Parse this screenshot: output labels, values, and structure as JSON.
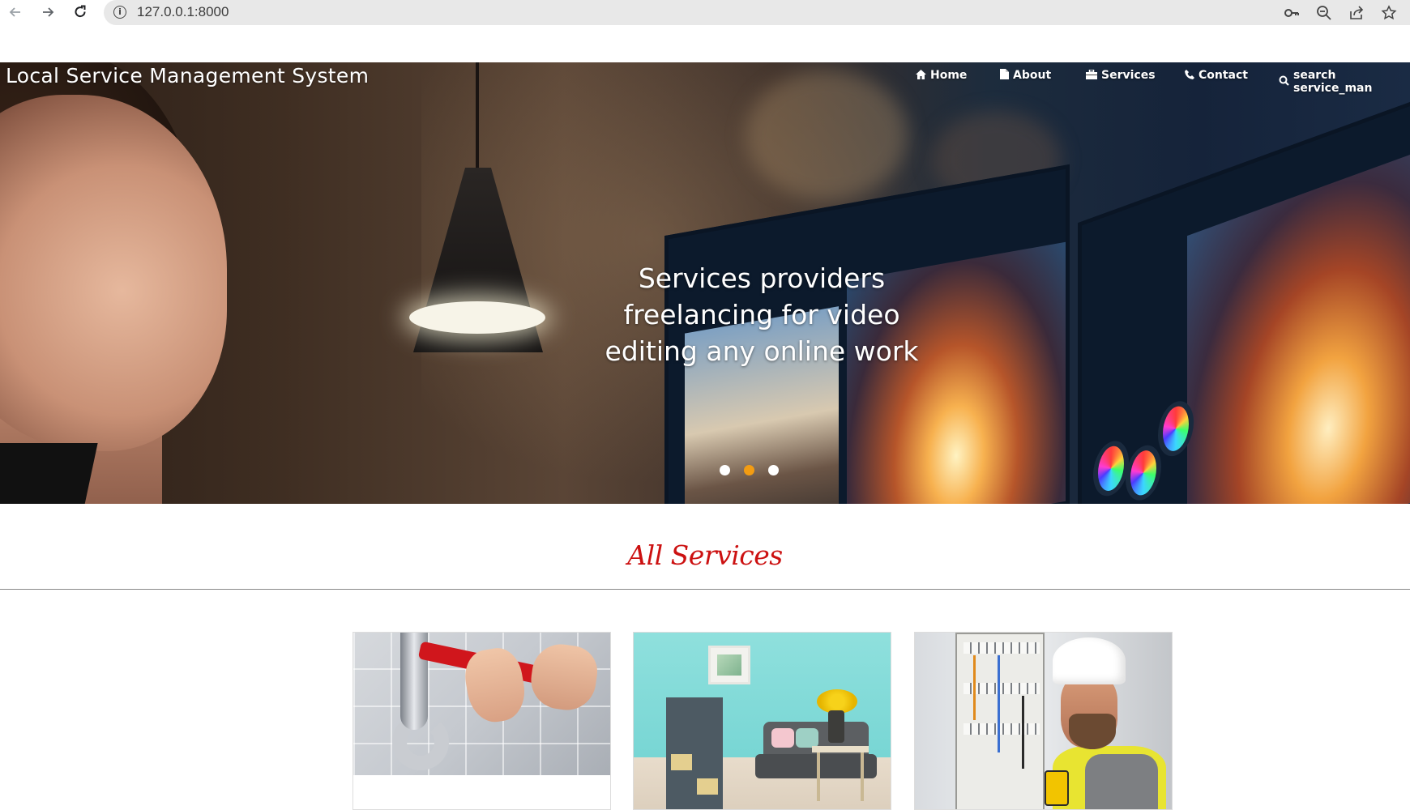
{
  "browser": {
    "url": "127.0.0.1:8000"
  },
  "header": {
    "brand": "Local Service Management System",
    "nav": [
      {
        "label": "Home",
        "icon": "home-icon"
      },
      {
        "label": "About",
        "icon": "file-icon"
      },
      {
        "label": "Services",
        "icon": "briefcase-icon"
      },
      {
        "label": "Contact",
        "icon": "phone-icon"
      },
      {
        "label": "search service_man",
        "icon": "search-icon"
      }
    ]
  },
  "hero": {
    "caption_lines": [
      "Services providers",
      "freelancing for video",
      "editing any online work"
    ],
    "slides": 3,
    "active_slide": 2,
    "colors": {
      "dot": "#ffffff",
      "dot_active": "#f39c12"
    }
  },
  "services": {
    "title": "All Services",
    "title_color": "#cc1111",
    "cards": [
      {
        "image": "plumbing-wrench-pipe"
      },
      {
        "image": "living-room-interior"
      },
      {
        "image": "electrician-with-helmet"
      }
    ]
  }
}
